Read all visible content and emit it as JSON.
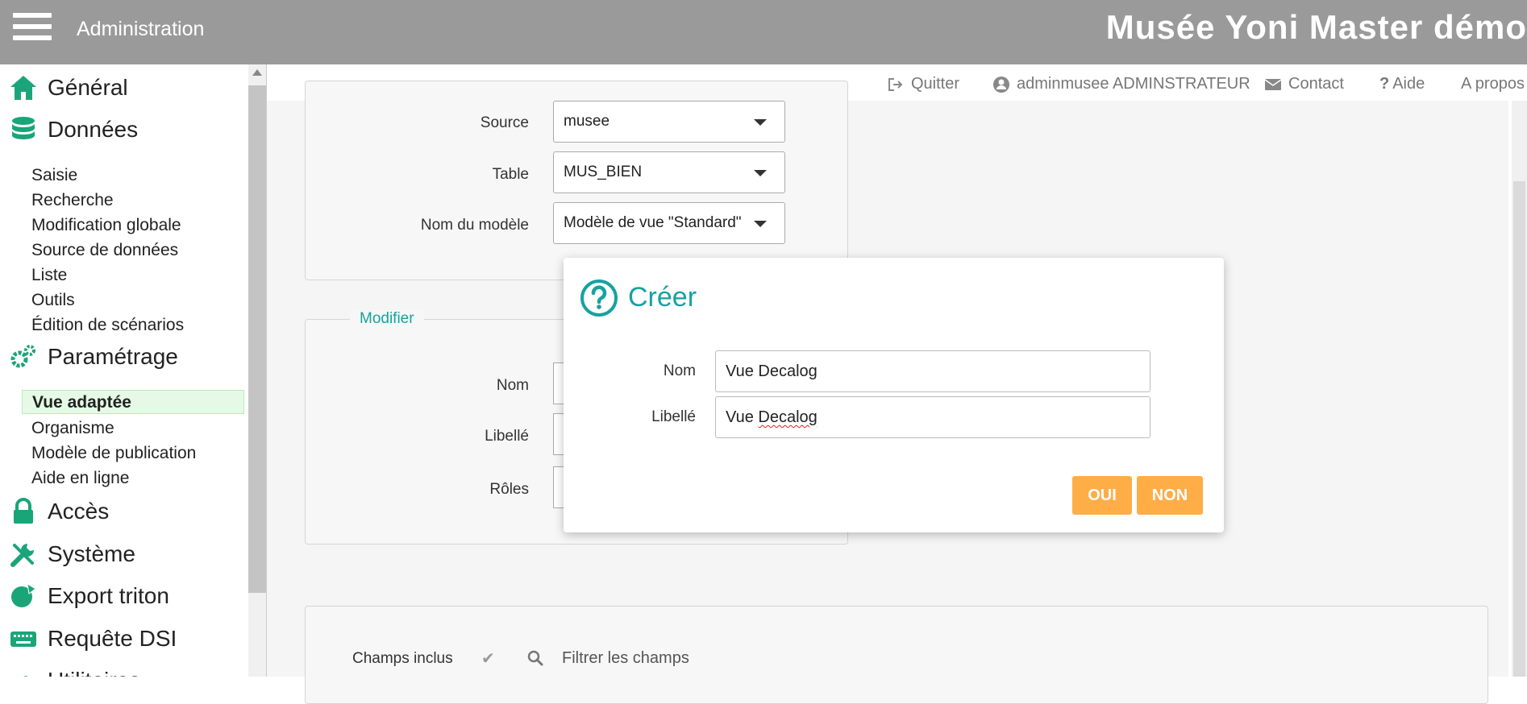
{
  "topbar": {
    "admin_label": "Administration",
    "app_title": "Musée Yoni Master démo"
  },
  "sidebar": {
    "general": "Général",
    "donnees": "Données",
    "donnees_items": [
      "Saisie",
      "Recherche",
      "Modification globale",
      "Source de données",
      "Liste",
      "Outils",
      "Édition de scénarios"
    ],
    "parametrage": "Paramétrage",
    "parametrage_items": [
      "Vue adaptée",
      "Organisme",
      "Modèle de publication",
      "Aide en ligne"
    ],
    "acces": "Accès",
    "systeme": "Système",
    "export": "Export triton",
    "requete": "Requête DSI",
    "utilities": "Utilitaires"
  },
  "header": {
    "quit": "Quitter",
    "user": "adminmusee ADMINSTRATEUR",
    "contact": "Contact",
    "help": "Aide",
    "about": "A propos"
  },
  "form": {
    "source_label": "Source",
    "source_value": "musee",
    "table_label": "Table",
    "table_value": "MUS_BIEN",
    "model_label": "Nom du modèle",
    "model_value": "Modèle de vue \"Standard\"",
    "modify_legend": "Modifier",
    "nom_label": "Nom",
    "libelle_label": "Libellé",
    "roles_label": "Rôles"
  },
  "modal": {
    "title": "Créer",
    "nom_label": "Nom",
    "nom_value": "Vue Decalog",
    "libelle_label": "Libellé",
    "libelle_prefix": "Vue ",
    "libelle_word": "Decalog",
    "oui": "OUI",
    "non": "NON"
  },
  "fields": {
    "included_label": "Champs inclus",
    "filter_placeholder": "Filtrer les champs"
  },
  "colors": {
    "accent": "#16a2a0",
    "button": "#ffad47",
    "topbar": "#9a9a9a",
    "icon_green": "#1aa579"
  }
}
